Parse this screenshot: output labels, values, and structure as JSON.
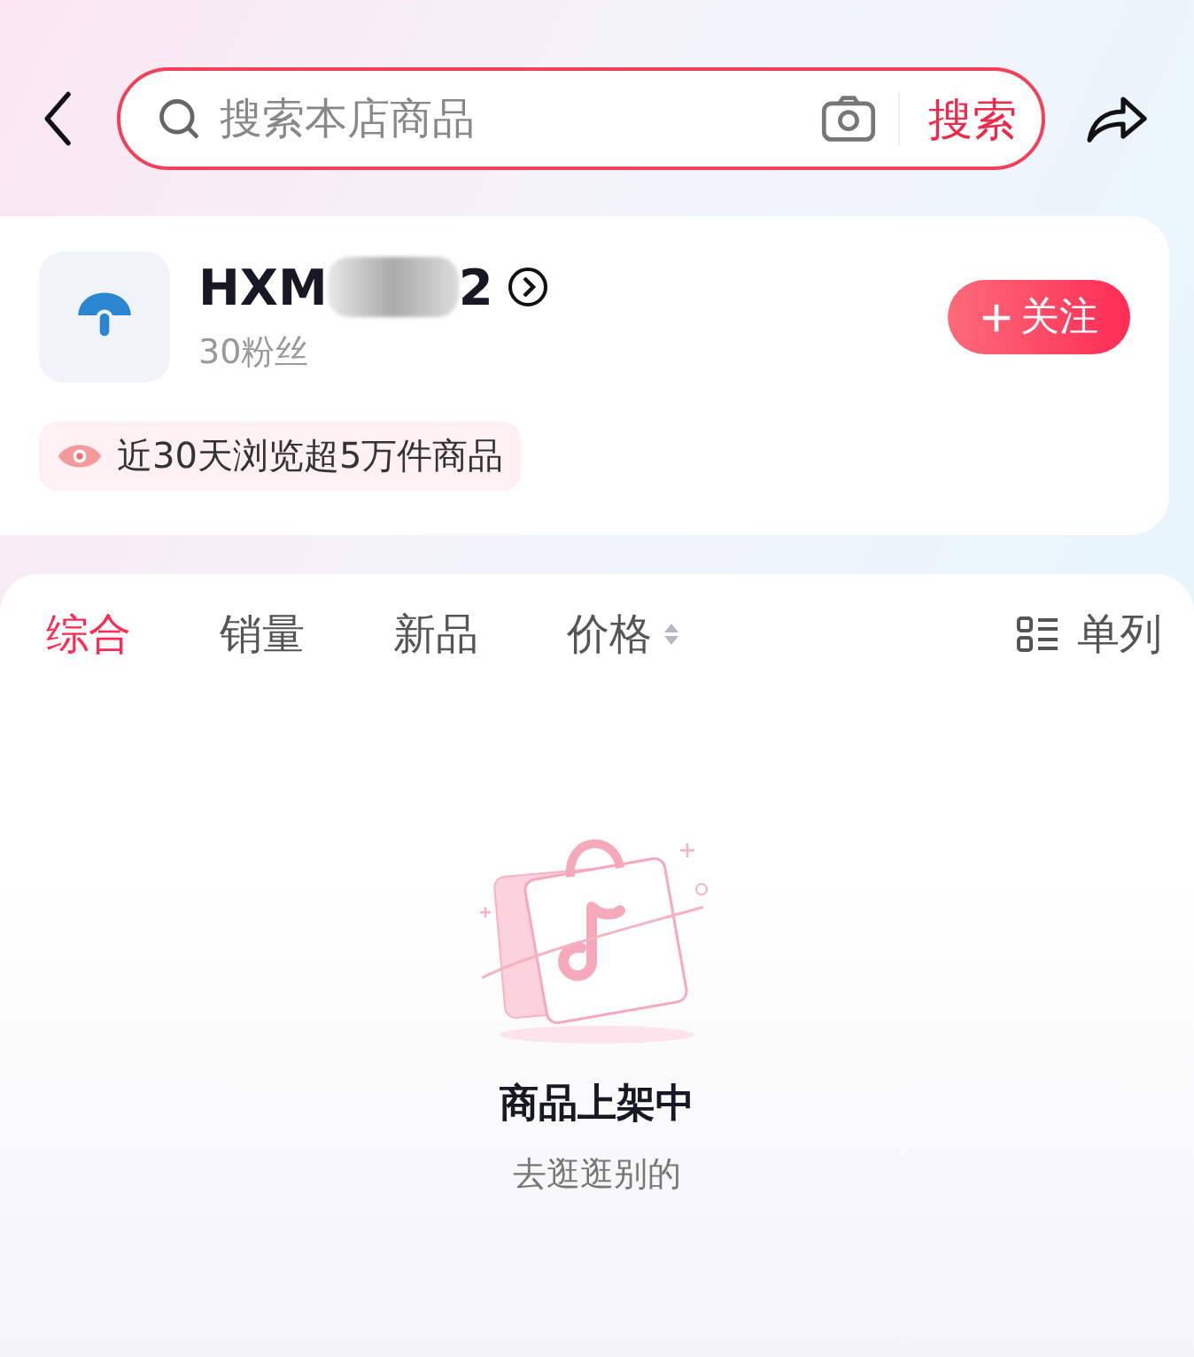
{
  "search": {
    "placeholder": "搜索本店商品",
    "button": "搜索"
  },
  "store": {
    "name_start": "HXM",
    "name_end": "2",
    "followers": "30粉丝",
    "follow_button": "关注",
    "highlight": "近30天浏览超5万件商品"
  },
  "tabs": [
    {
      "label": "综合",
      "selected": true,
      "kind": "plain"
    },
    {
      "label": "销量",
      "selected": false,
      "kind": "plain"
    },
    {
      "label": "新品",
      "selected": false,
      "kind": "plain"
    },
    {
      "label": "价格",
      "selected": false,
      "kind": "sort"
    }
  ],
  "layout_toggle": "单列",
  "empty_state": {
    "title": "商品上架中",
    "subtitle": "去逛逛别的"
  }
}
